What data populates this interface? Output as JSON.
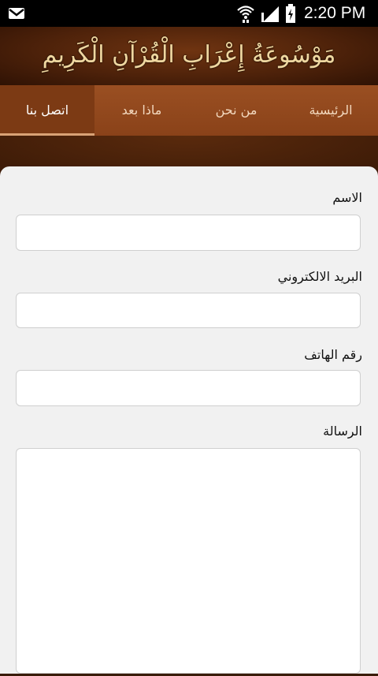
{
  "status_bar": {
    "time": "2:20 PM",
    "icons": [
      "gmail-icon",
      "wifi-icon",
      "signal-icon",
      "battery-charging-icon"
    ]
  },
  "header": {
    "title": "مَوْسُوعَةُ إِعْرَابِ الْقُرْآنِ الْكَرِيمِ"
  },
  "tabs": [
    {
      "label": "الرئيسية",
      "active": false
    },
    {
      "label": "من نحن",
      "active": false
    },
    {
      "label": "ماذا بعد",
      "active": false
    },
    {
      "label": "اتصل بنا",
      "active": true
    }
  ],
  "form": {
    "name_label": "الاسم",
    "name_value": "",
    "email_label": "البريد الالكتروني",
    "email_value": "",
    "phone_label": "رقم الهاتف",
    "phone_value": "",
    "message_label": "الرسالة",
    "message_value": ""
  },
  "colors": {
    "banner": "#4e220a",
    "tab_bar": "#9a4f22",
    "tab_active": "#7c3a14",
    "panel": "#f1f1f1"
  }
}
